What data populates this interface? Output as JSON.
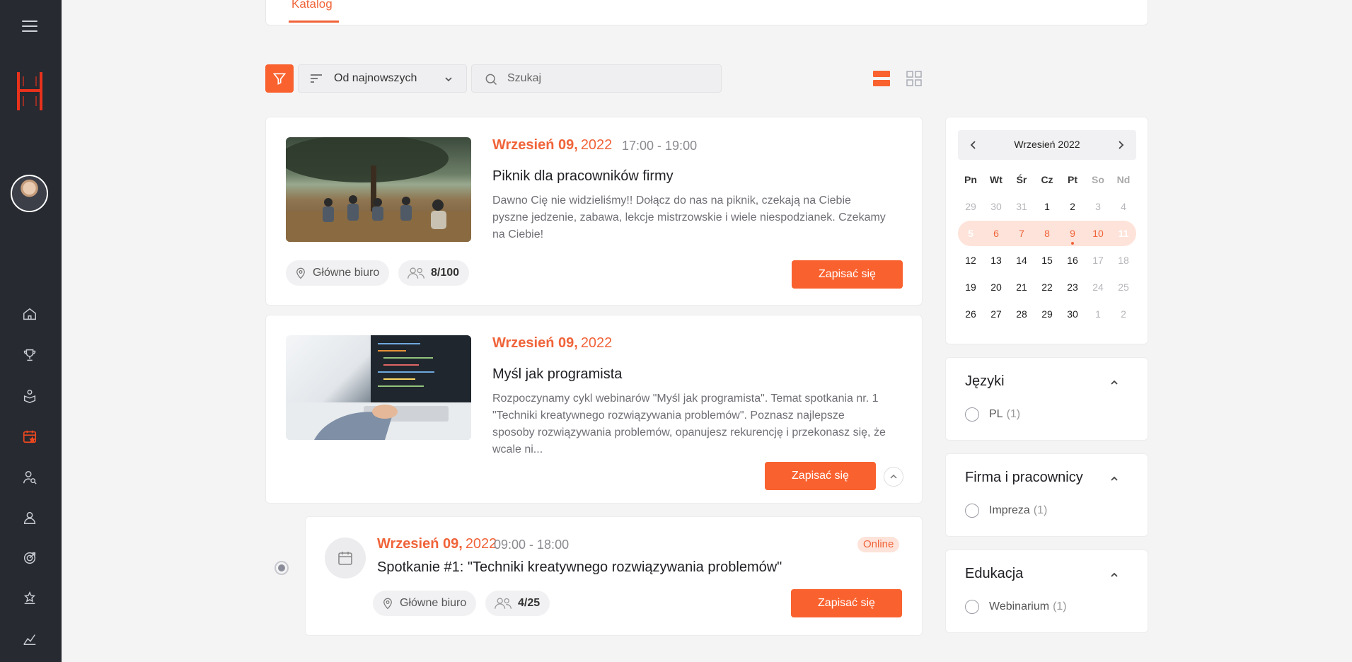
{
  "topbar": {
    "tab_label": "Katalog"
  },
  "toolbar": {
    "sort_label": "Od najnowszych",
    "search_placeholder": "Szukaj"
  },
  "events": [
    {
      "date_day": "Wrzesień 09,",
      "date_year": "2022",
      "time": "17:00 - 19:00",
      "title": "Piknik dla pracowników firmy",
      "description": "Dawno Cię nie widzieliśmy!! Dołącz do nas na piknik, czekają na Ciebie pyszne jedzenie, zabawa, lekcje mistrzowskie i wiele niespodzianek. Czekamy na Ciebie!",
      "location": "Główne biuro",
      "participants": "8/100",
      "cta": "Zapisać się"
    },
    {
      "date_day": "Wrzesień 09,",
      "date_year": "2022",
      "title": "Myśl jak programista",
      "description": "Rozpoczynamy cykl webinarów \"Myśl jak programista\". Temat spotkania nr. 1 \"Techniki kreatywnego rozwiązywania problemów\". Poznasz najlepsze sposoby rozwiązywania problemów, opanujesz rekurencję i przekonasz się, że wcale ni...",
      "cta": "Zapisać się"
    },
    {
      "date_day": "Wrzesień 09,",
      "date_year": "2022",
      "time": "09:00 - 18:00",
      "title": "Spotkanie #1: \"Techniki kreatywnego rozwiązywania problemów\"",
      "badge": "Online",
      "location": "Główne biuro",
      "participants": "4/25",
      "cta": "Zapisać się"
    }
  ],
  "calendar": {
    "month_label": "Wrzesień 2022",
    "weekdays": [
      "Pn",
      "Wt",
      "Śr",
      "Cz",
      "Pt",
      "So",
      "Nd"
    ],
    "weeks": [
      [
        "29",
        "30",
        "31",
        "1",
        "2",
        "3",
        "4"
      ],
      [
        "5",
        "6",
        "7",
        "8",
        "9",
        "10",
        "11"
      ],
      [
        "12",
        "13",
        "14",
        "15",
        "16",
        "17",
        "18"
      ],
      [
        "19",
        "20",
        "21",
        "22",
        "23",
        "24",
        "25"
      ],
      [
        "26",
        "27",
        "28",
        "29",
        "30",
        "1",
        "2"
      ]
    ],
    "selected_range": [
      "5",
      "11"
    ],
    "event_day": "9"
  },
  "filters": [
    {
      "title": "Języki",
      "option": "PL",
      "count": "(1)"
    },
    {
      "title": "Firma i pracownicy",
      "option": "Impreza",
      "count": "(1)"
    },
    {
      "title": "Edukacja",
      "option": "Webinarium",
      "count": "(1)"
    }
  ],
  "colors": {
    "accent": "#f9622f",
    "sidebar": "#272a31",
    "background": "#f4f4f5"
  },
  "sidebar": {
    "icons": [
      "home-icon",
      "trophy-icon",
      "education-icon",
      "calendar-icon",
      "user-search-icon",
      "user-icon",
      "target-icon",
      "stars-icon",
      "growth-icon"
    ],
    "active": "calendar-icon"
  }
}
